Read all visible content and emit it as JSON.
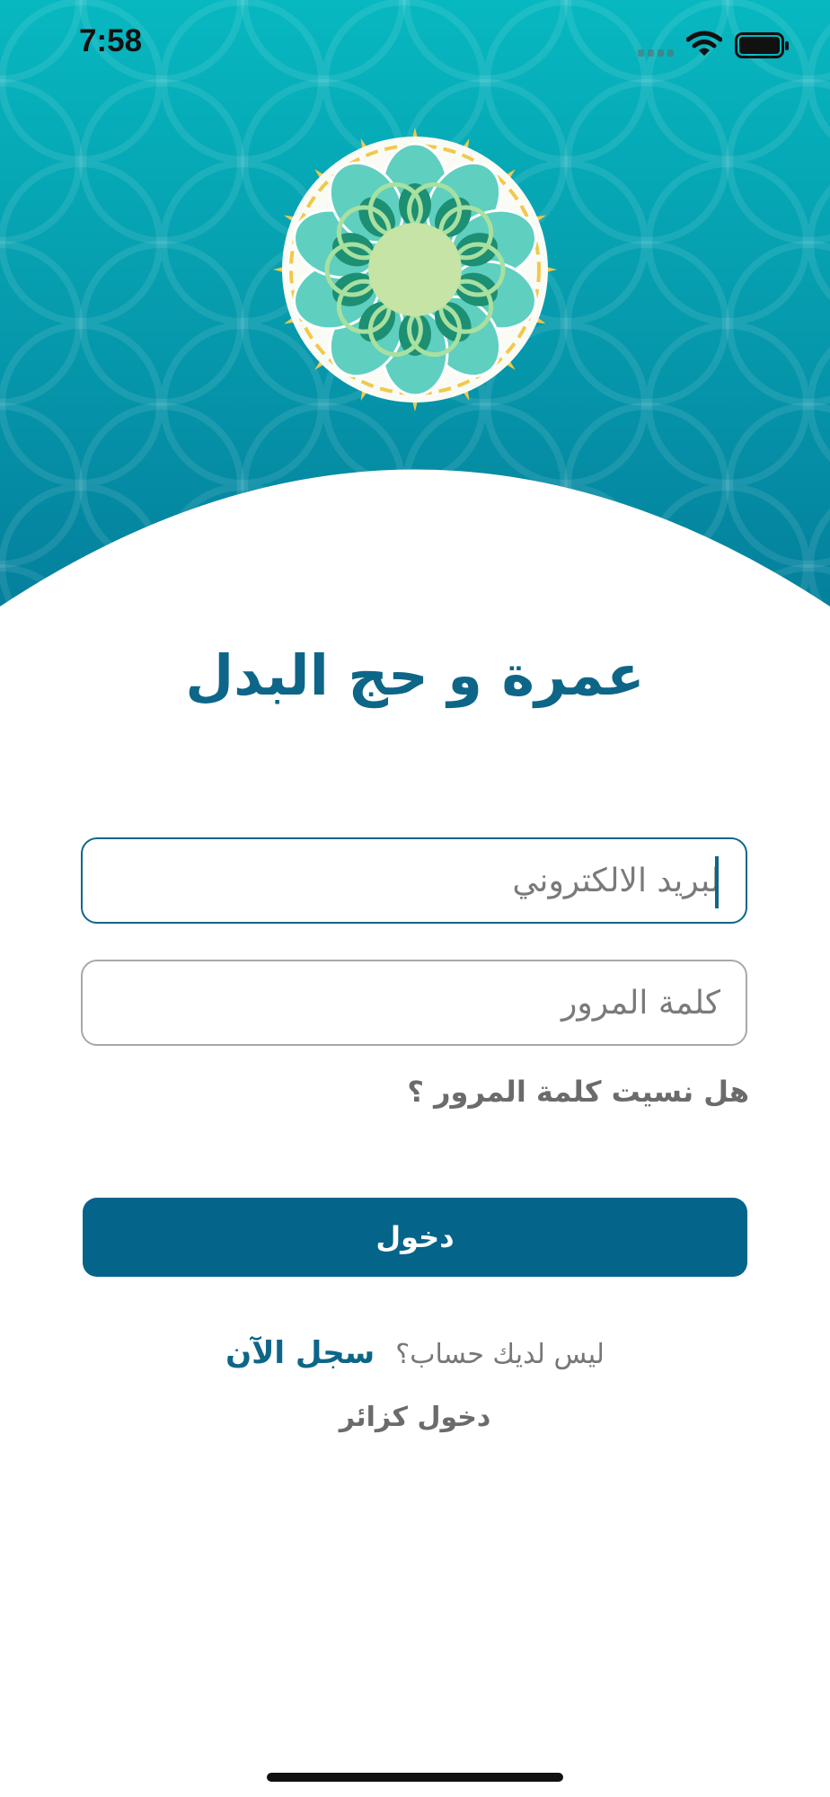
{
  "status_bar": {
    "time": "7:58",
    "icons": [
      "signal-icon",
      "wifi-icon",
      "battery-icon"
    ]
  },
  "header": {
    "logo": "rosette-logo",
    "colors": {
      "top": "#07b8c0",
      "bottom": "#047e9b"
    }
  },
  "app": {
    "title": "عمرة و حج البدل"
  },
  "form": {
    "email": {
      "value": "",
      "placeholder": "لبريد الالكتروني"
    },
    "password": {
      "value": "",
      "placeholder": "كلمة المرور"
    },
    "forgot_password": "هل نسيت كلمة المرور ؟",
    "login_label": "دخول"
  },
  "signup": {
    "no_account": "ليس لديك حساب؟",
    "register_now": "سجل الآن"
  },
  "guest": {
    "label": "دخول كزائر"
  },
  "colors": {
    "primary": "#046489",
    "text_muted": "#6b6b6b"
  }
}
